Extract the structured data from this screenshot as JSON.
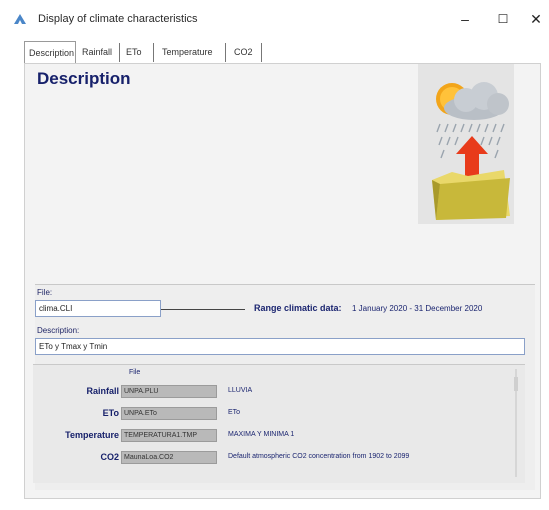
{
  "window": {
    "title": "Display of climate characteristics",
    "minimize": "–",
    "maximize": "☐",
    "close": "✕"
  },
  "tabs": [
    {
      "label": "Description",
      "active": true
    },
    {
      "label": "Rainfall"
    },
    {
      "label": "ETo"
    },
    {
      "label": "Temperature"
    },
    {
      "label": "CO2"
    }
  ],
  "main": {
    "heading": "Description",
    "file_label": "File:",
    "file_value": "clima.CLI",
    "range_label": "Range climatic data:",
    "range_value": "1 January 2020 - 31 December 2020",
    "description_label": "Description:",
    "description_value": "ETo y Tmax y Tmin"
  },
  "files": {
    "header": "File",
    "rows": [
      {
        "label": "Rainfall",
        "file": "UNPA.PLU",
        "desc": "LLUVIA"
      },
      {
        "label": "ETo",
        "file": "UNPA.ETo",
        "desc": "ETo"
      },
      {
        "label": "Temperature",
        "file": "TEMPERATURA1.TMP",
        "desc": "MAXIMA Y MINIMA 1"
      },
      {
        "label": "CO2",
        "file": "MaunaLoa.CO2",
        "desc": "Default atmospheric CO2 concentration from 1902 to 2099"
      }
    ]
  },
  "icons": {
    "app": "app-icon",
    "illustration": "weather-folder-icon"
  },
  "colors": {
    "heading": "#17216b",
    "label": "#1b2570",
    "panel": "#f3f3f3",
    "field_border": "#8aa0c8",
    "file_field": "#b9b9b9"
  }
}
